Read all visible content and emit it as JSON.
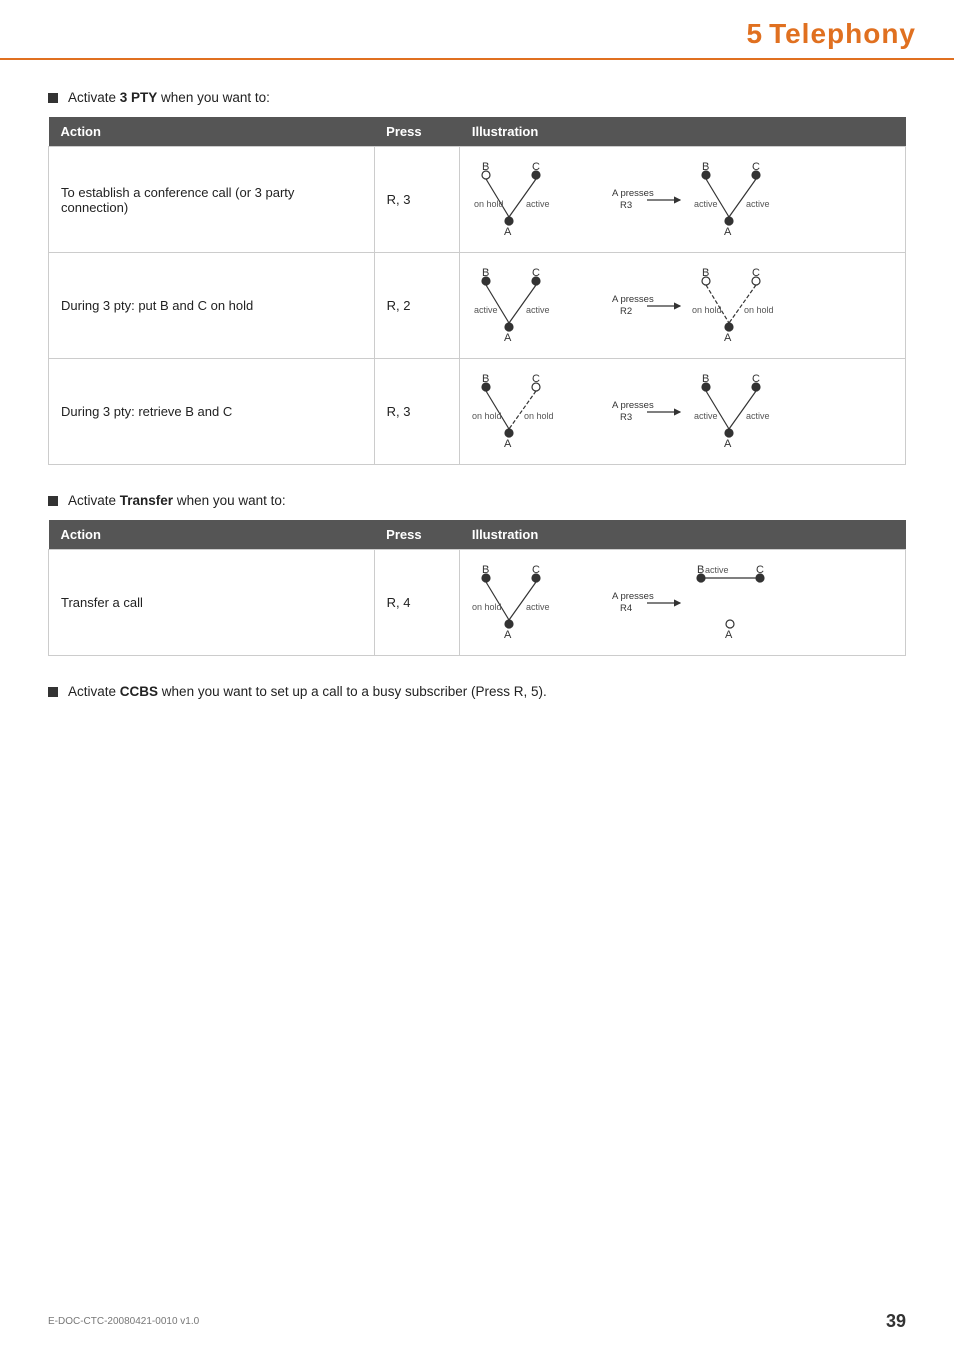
{
  "header": {
    "chapter_num": "5",
    "chapter_title": "Telephony"
  },
  "footer": {
    "doc_id": "E-DOC-CTC-20080421-0010 v1.0",
    "page_num": "39"
  },
  "sections": [
    {
      "bullet_text_plain": "Activate ",
      "bullet_text_bold": "3 PTY",
      "bullet_text_after": " when you want to:",
      "table": {
        "col_action": "Action",
        "col_press": "Press",
        "col_illus": "Illustration",
        "rows": [
          {
            "action": "To establish a conference call (or 3 party connection)",
            "press": "R, 3",
            "illus_type": "3pty_establish"
          },
          {
            "action": "During 3 pty: put B and C on hold",
            "press": "R, 2",
            "illus_type": "3pty_hold_bc"
          },
          {
            "action": "During 3 pty: retrieve B and C",
            "press": "R, 3",
            "illus_type": "3pty_retrieve_bc"
          }
        ]
      }
    },
    {
      "bullet_text_plain": "Activate ",
      "bullet_text_bold": "Transfer",
      "bullet_text_after": " when you want to:",
      "table": {
        "col_action": "Action",
        "col_press": "Press",
        "col_illus": "Illustration",
        "rows": [
          {
            "action": "Transfer a call",
            "press": "R, 4",
            "illus_type": "transfer_call"
          }
        ]
      }
    }
  ],
  "bottom_bullet": {
    "plain": "Activate ",
    "bold": "CCBS",
    "after": " when you want to set up a call to a busy subscriber (Press R, 5)."
  }
}
